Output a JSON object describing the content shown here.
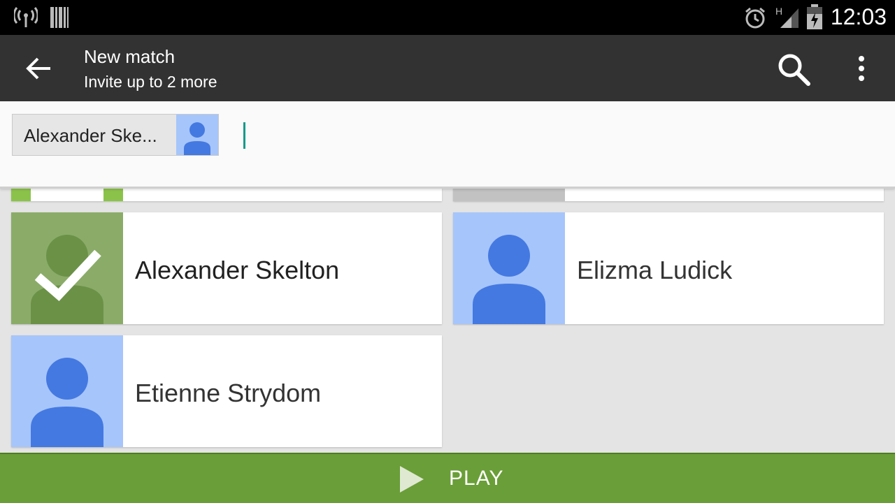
{
  "status_bar": {
    "time": "12:03",
    "icons": [
      "wireless-signal-icon",
      "barcode-icon",
      "alarm-icon",
      "network-signal-icon",
      "battery-icon"
    ],
    "network_type": "H"
  },
  "action_bar": {
    "title": "New match",
    "subtitle": "Invite up to 2 more",
    "icons": [
      "back-arrow-icon",
      "search-icon",
      "overflow-menu-icon"
    ]
  },
  "invite_input": {
    "chips": [
      {
        "label": "Alexander Ske..."
      }
    ]
  },
  "players": [
    {
      "name": "Alexander Skelton",
      "selected": true
    },
    {
      "name": "Elizma Ludick",
      "selected": false
    },
    {
      "name": "Etienne Strydom",
      "selected": false
    }
  ],
  "play_button": {
    "label": "PLAY"
  },
  "colors": {
    "action_bar": "#323232",
    "play_bar": "#6a9e38",
    "avatar_bg": "#a6c5fb",
    "avatar_person": "#4479e1",
    "selected_avatar_bg": "#8aac68",
    "cursor": "#169a8a"
  }
}
